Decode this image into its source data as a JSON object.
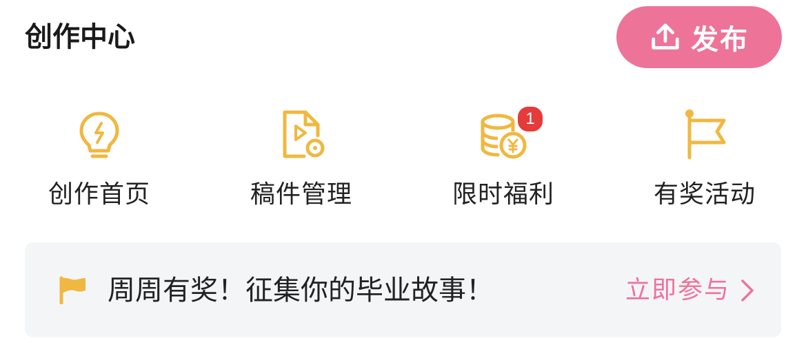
{
  "header": {
    "title": "创作中心",
    "publish_label": "发布"
  },
  "nav": {
    "items": [
      {
        "label": "创作首页",
        "icon": "lightbulb-icon"
      },
      {
        "label": "稿件管理",
        "icon": "video-file-settings-icon"
      },
      {
        "label": "限时福利",
        "icon": "coins-icon",
        "badge": "1"
      },
      {
        "label": "有奖活动",
        "icon": "flag-icon"
      }
    ]
  },
  "banner": {
    "text": "周周有奖！征集你的毕业故事！",
    "cta_label": "立即参与",
    "icon": "flag-icon"
  },
  "colors": {
    "accent": "#ee7399",
    "icon": "#f0b840",
    "badge": "#e53b3b",
    "banner_bg": "#f4f5f7"
  }
}
